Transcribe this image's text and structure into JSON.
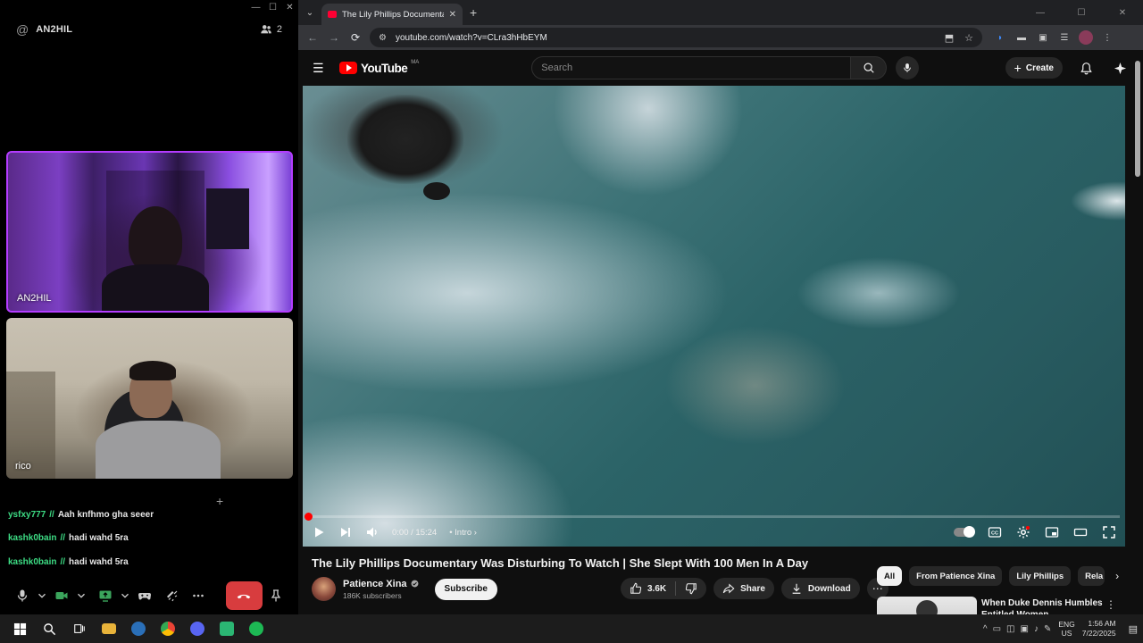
{
  "discord": {
    "channel": "AN2HIL",
    "participant_count": "2",
    "tiles": [
      {
        "label": "AN2HIL"
      },
      {
        "label": "rico"
      }
    ],
    "messages": [
      {
        "user": "ysfxy777",
        "sep": "//",
        "text": "Aah knfhmo gha seeer"
      },
      {
        "user": "kashk0bain",
        "sep": "//",
        "text": "hadi wahd 5ra"
      },
      {
        "user": "kashk0bain",
        "sep": "//",
        "text": "hadi wahd 5ra"
      }
    ],
    "colors": {
      "hangup": "#d83c3e",
      "speaking_border": "#b43cff",
      "username": "#3ddc84"
    }
  },
  "browser": {
    "tab_title": "The Lily Phillips Documentary W...",
    "url": "youtube.com/watch?v=CLra3hHbEYM"
  },
  "youtube": {
    "logo_text": "YouTube",
    "country_code": "MA",
    "search_placeholder": "Search",
    "create_label": "Create",
    "player": {
      "time": "0:00 / 15:24",
      "chapter": "Intro",
      "progress": 0.0
    },
    "video": {
      "title": "The Lily Phillips Documentary Was Disturbing To Watch | She Slept With 100 Men In A Day",
      "channel": "Patience Xina",
      "subscribers": "186K subscribers",
      "subscribe_label": "Subscribe",
      "likes": "3.6K",
      "share_label": "Share",
      "download_label": "Download"
    },
    "chips": [
      "All",
      "From Patience Xina",
      "Lily Phillips",
      "Rela"
    ],
    "recommendation": {
      "title": "When Duke Dennis Humbles Entitled Women"
    }
  },
  "taskbar": {
    "lang_top": "ENG",
    "lang_bottom": "US",
    "time": "1:56 AM",
    "date": "7/22/2025"
  }
}
